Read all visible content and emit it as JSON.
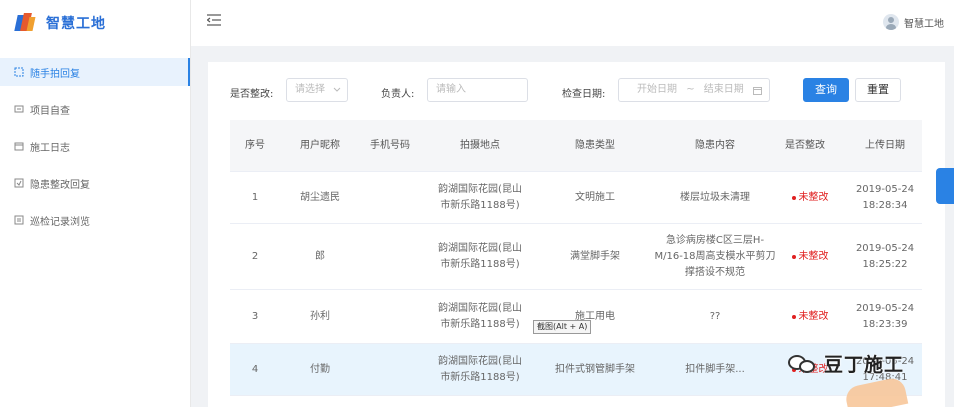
{
  "app": {
    "title": "智慧工地"
  },
  "header": {
    "user_name": "智慧工地"
  },
  "sidebar": {
    "items": [
      {
        "label": "随手拍回复",
        "icon": "photo-icon",
        "active": true
      },
      {
        "label": "项目自查",
        "icon": "inspect-icon",
        "active": false
      },
      {
        "label": "施工日志",
        "icon": "calendar-icon",
        "active": false
      },
      {
        "label": "隐患整改回复",
        "icon": "rectify-icon",
        "active": false
      },
      {
        "label": "巡检记录浏览",
        "icon": "record-icon",
        "active": false
      }
    ]
  },
  "filters": {
    "rectified_label": "是否整改:",
    "rectified_placeholder": "请选择",
    "owner_label": "负责人:",
    "owner_placeholder": "请输入",
    "date_label": "检查日期:",
    "date_start_placeholder": "开始日期",
    "date_separator": "~",
    "date_end_placeholder": "结束日期",
    "search_button": "查询",
    "reset_button": "重置"
  },
  "table": {
    "columns": [
      "序号",
      "用户昵称",
      "手机号码",
      "拍摄地点",
      "隐患类型",
      "隐患内容",
      "是否整改",
      "上传日期"
    ],
    "rows": [
      {
        "no": "1",
        "nickname": "胡尘遗民",
        "phone": "",
        "location": "韵湖国际花园(昆山市新乐路1188号)",
        "hazard_type": "文明施工",
        "hazard_content": "楼层垃圾未清理",
        "status": "未整改",
        "date": "2019-05-24",
        "time": "18:28:34"
      },
      {
        "no": "2",
        "nickname": "郎",
        "phone": "",
        "location": "韵湖国际花园(昆山市新乐路1188号)",
        "hazard_type": "满堂脚手架",
        "hazard_content": "急诊病房楼C区三层H-M/16-18周高支模水平剪刀撑搭设不规范",
        "status": "未整改",
        "date": "2019-05-24",
        "time": "18:25:22"
      },
      {
        "no": "3",
        "nickname": "孙利",
        "phone": "",
        "location": "韵湖国际花园(昆山市新乐路1188号)",
        "hazard_type": "施工用电",
        "hazard_content": "??",
        "status": "未整改",
        "date": "2019-05-24",
        "time": "18:23:39"
      },
      {
        "no": "4",
        "nickname": "付勤",
        "phone": "",
        "location": "韵湖国际花园(昆山市新乐路1188号)",
        "hazard_type": "扣件式钢管脚手架",
        "hazard_content": "扣件脚手架...",
        "status": "未整改",
        "date": "2019-05-24",
        "time": "17:48:41"
      }
    ]
  },
  "tooltip": {
    "text": "截图(Alt + A)"
  },
  "watermark": {
    "text": "豆丁施工"
  },
  "colors": {
    "primary": "#2a82e4",
    "danger": "#e02020",
    "logo_blue": "#2a6fd6",
    "logo_orange": "#e65a2e"
  }
}
